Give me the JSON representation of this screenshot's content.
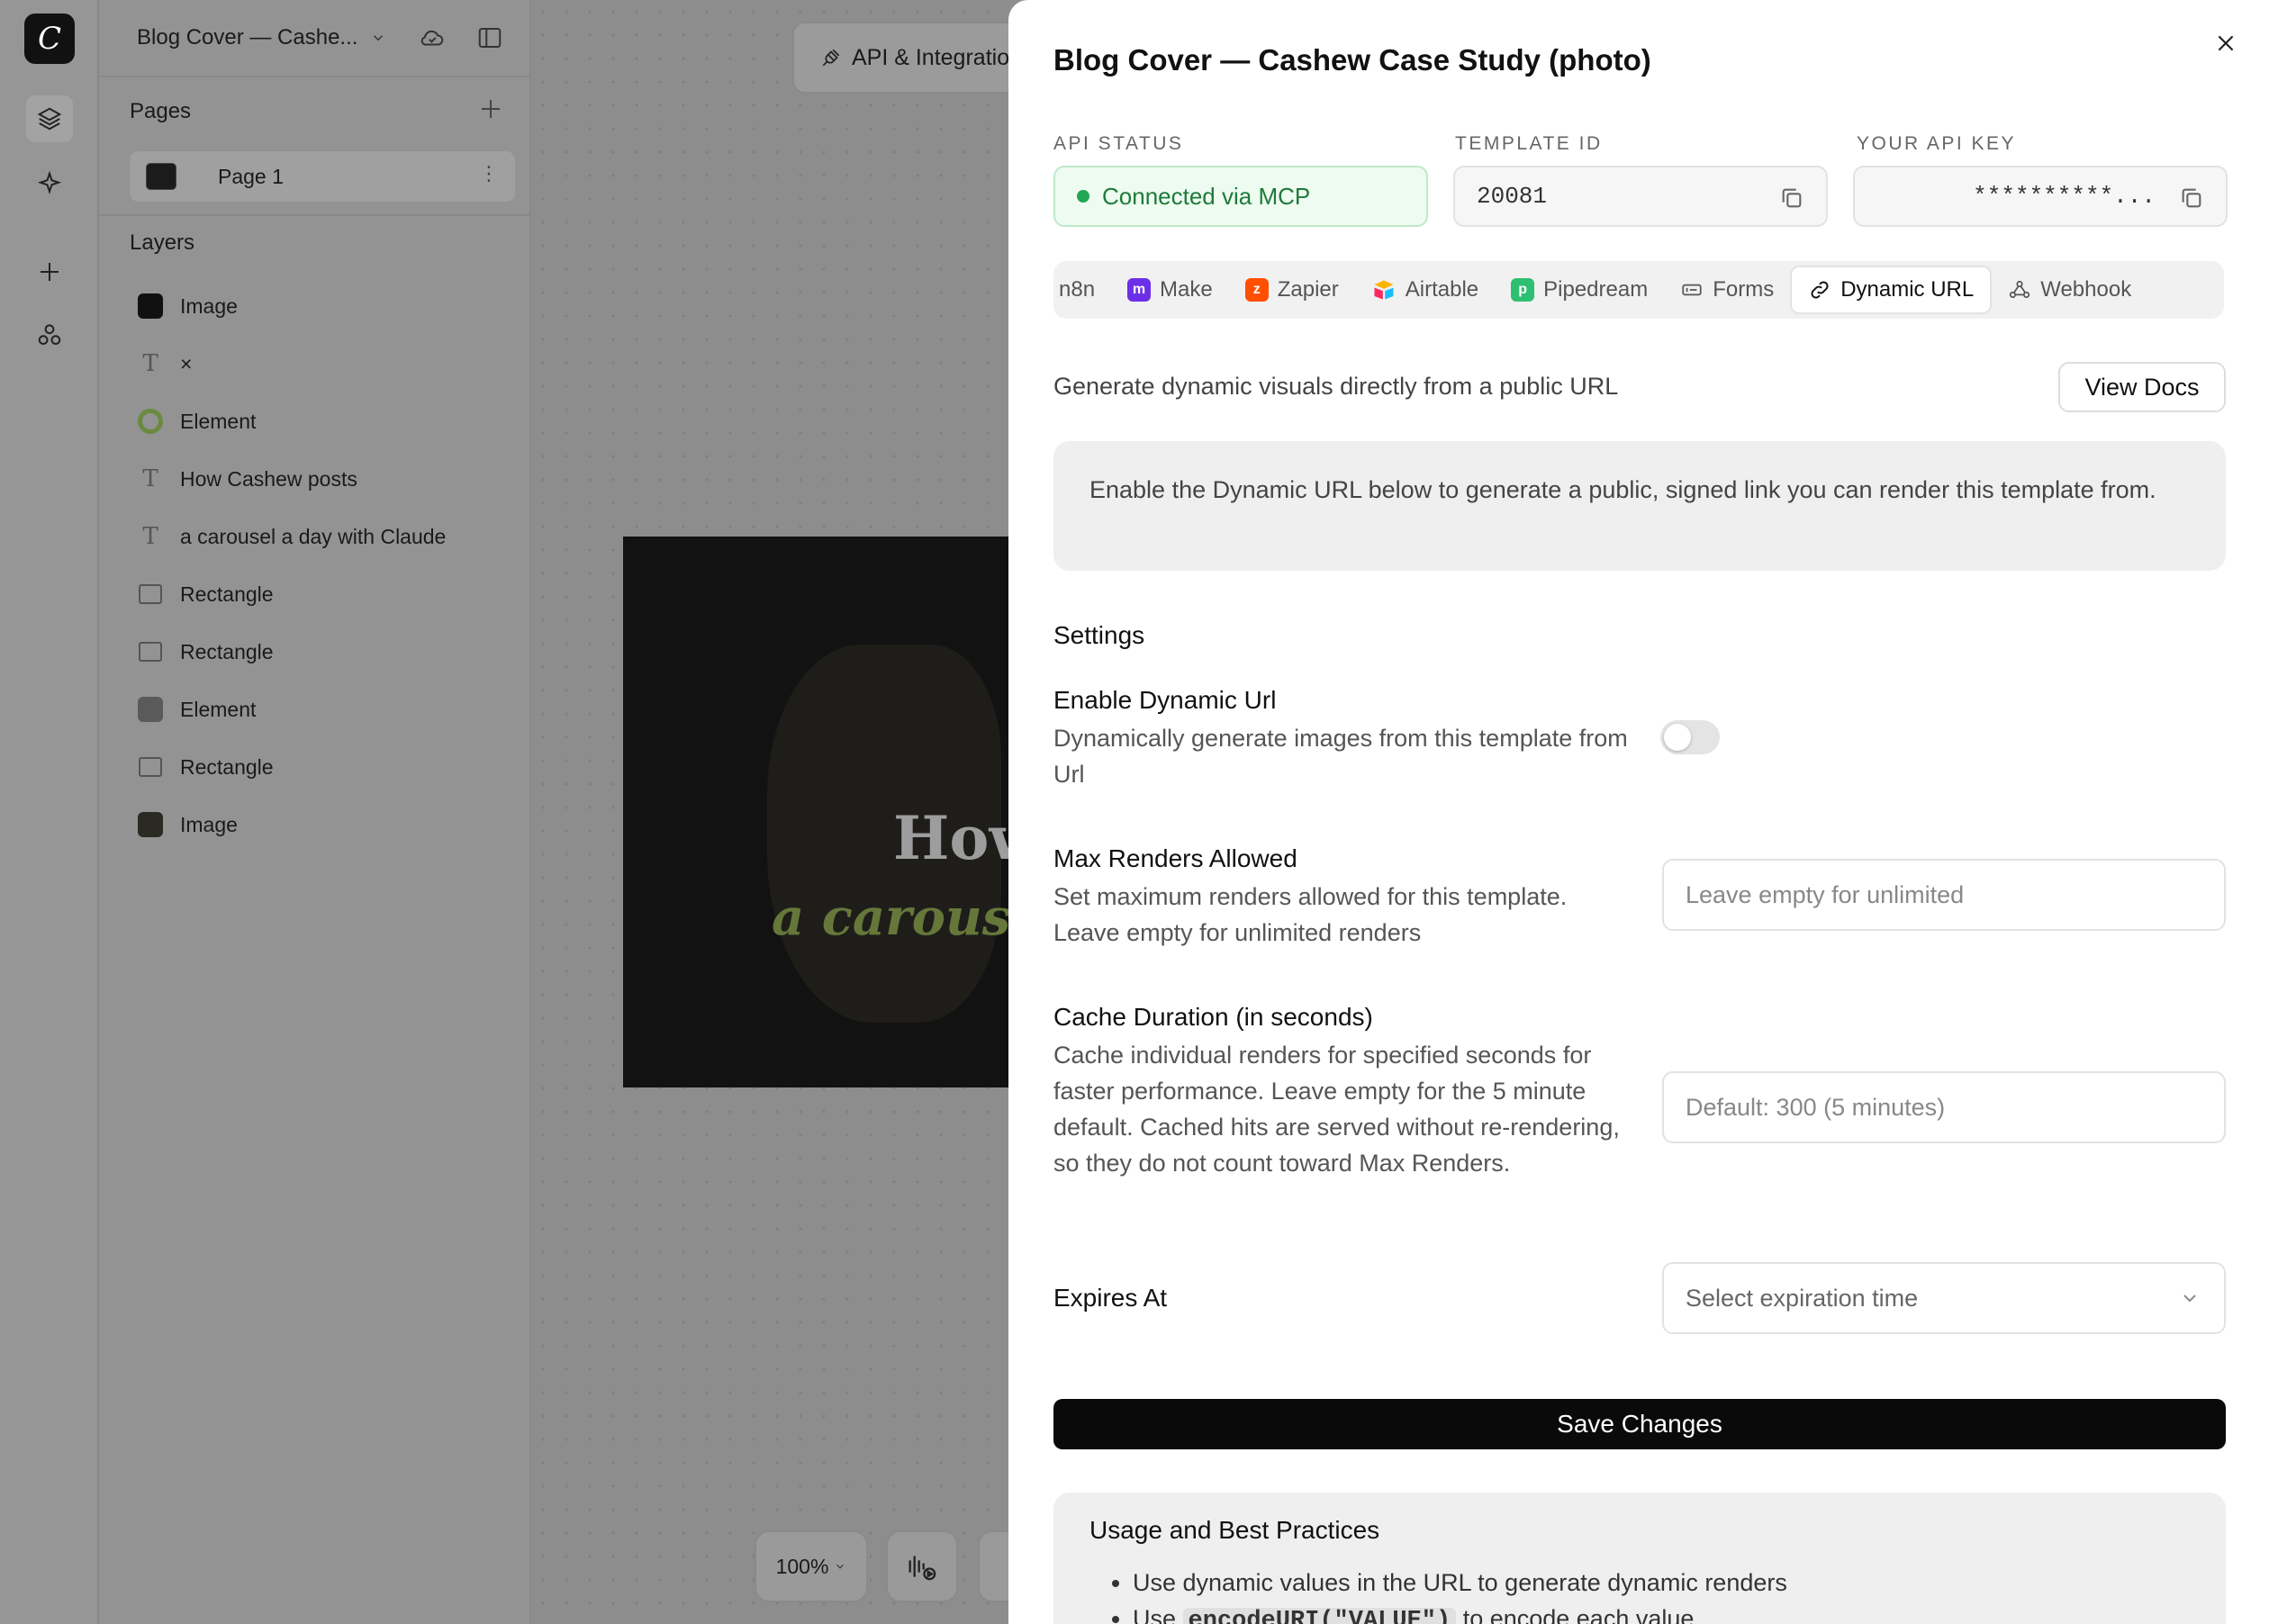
{
  "app": {
    "document_title": "Blog Cover — Cashe...",
    "pages_label": "Pages",
    "pages": [
      {
        "label": "Page 1"
      }
    ],
    "layers_label": "Layers",
    "layers": [
      {
        "label": "Image",
        "icon": "image-thumb-icon"
      },
      {
        "label": "×",
        "icon": "text-icon"
      },
      {
        "label": "Element",
        "icon": "element-thumb-icon"
      },
      {
        "label": "How Cashew posts",
        "icon": "text-icon"
      },
      {
        "label": "a carousel a day with Claude",
        "icon": "text-icon"
      },
      {
        "label": "Rectangle",
        "icon": "rectangle-icon"
      },
      {
        "label": "Rectangle",
        "icon": "rectangle-icon"
      },
      {
        "label": "Element",
        "icon": "element-thumb-icon"
      },
      {
        "label": "Rectangle",
        "icon": "rectangle-icon"
      },
      {
        "label": "Image",
        "icon": "image-thumb-icon"
      }
    ]
  },
  "canvas": {
    "api_button": "API & Integratio",
    "art_title": "How",
    "art_subtitle": "a carouse",
    "zoom": "100%"
  },
  "panel": {
    "title": "Blog Cover — Cashew Case Study (photo)",
    "api_status_label": "API STATUS",
    "api_status_value": "Connected via MCP",
    "template_id_label": "TEMPLATE ID",
    "template_id_value": "20081",
    "api_key_label": "YOUR API KEY",
    "api_key_value": "**********...",
    "tabs": [
      {
        "label": "n8n"
      },
      {
        "label": "Make"
      },
      {
        "label": "Zapier"
      },
      {
        "label": "Airtable"
      },
      {
        "label": "Pipedream"
      },
      {
        "label": "Forms"
      },
      {
        "label": "Dynamic URL"
      },
      {
        "label": "Webhook"
      }
    ],
    "active_tab": "Dynamic URL",
    "description": "Generate dynamic visuals directly from a public URL",
    "view_docs": "View Docs",
    "notice": "Enable the Dynamic URL below to generate a public, signed link you can render this template from.",
    "settings_heading": "Settings",
    "enable": {
      "title": "Enable Dynamic Url",
      "desc": "Dynamically generate images from this template from Url",
      "enabled": false
    },
    "max_renders": {
      "title": "Max Renders Allowed",
      "desc": "Set maximum renders allowed for this template. Leave empty for unlimited renders",
      "placeholder": "Leave empty for unlimited"
    },
    "cache": {
      "title": "Cache Duration (in seconds)",
      "desc": "Cache individual renders for specified seconds for faster performance. Leave empty for the 5 minute default. Cached hits are served without re-rendering, so they do not count toward Max Renders.",
      "placeholder": "Default: 300 (5 minutes)"
    },
    "expires": {
      "title": "Expires At",
      "placeholder": "Select expiration time"
    },
    "save": "Save Changes",
    "usage": {
      "title": "Usage and Best Practices",
      "item1": "Use dynamic values in the URL to generate dynamic renders",
      "item2_pre": "Use ",
      "item2_code": "encodeURI(\"VALUE\")",
      "item2_post": " to encode each value"
    }
  },
  "colors": {
    "accent_green": "#22a652",
    "save_bg": "#0a0a0a",
    "make": "#6d2ee8",
    "zapier": "#ff4f00",
    "pipedream": "#2fbf71"
  }
}
